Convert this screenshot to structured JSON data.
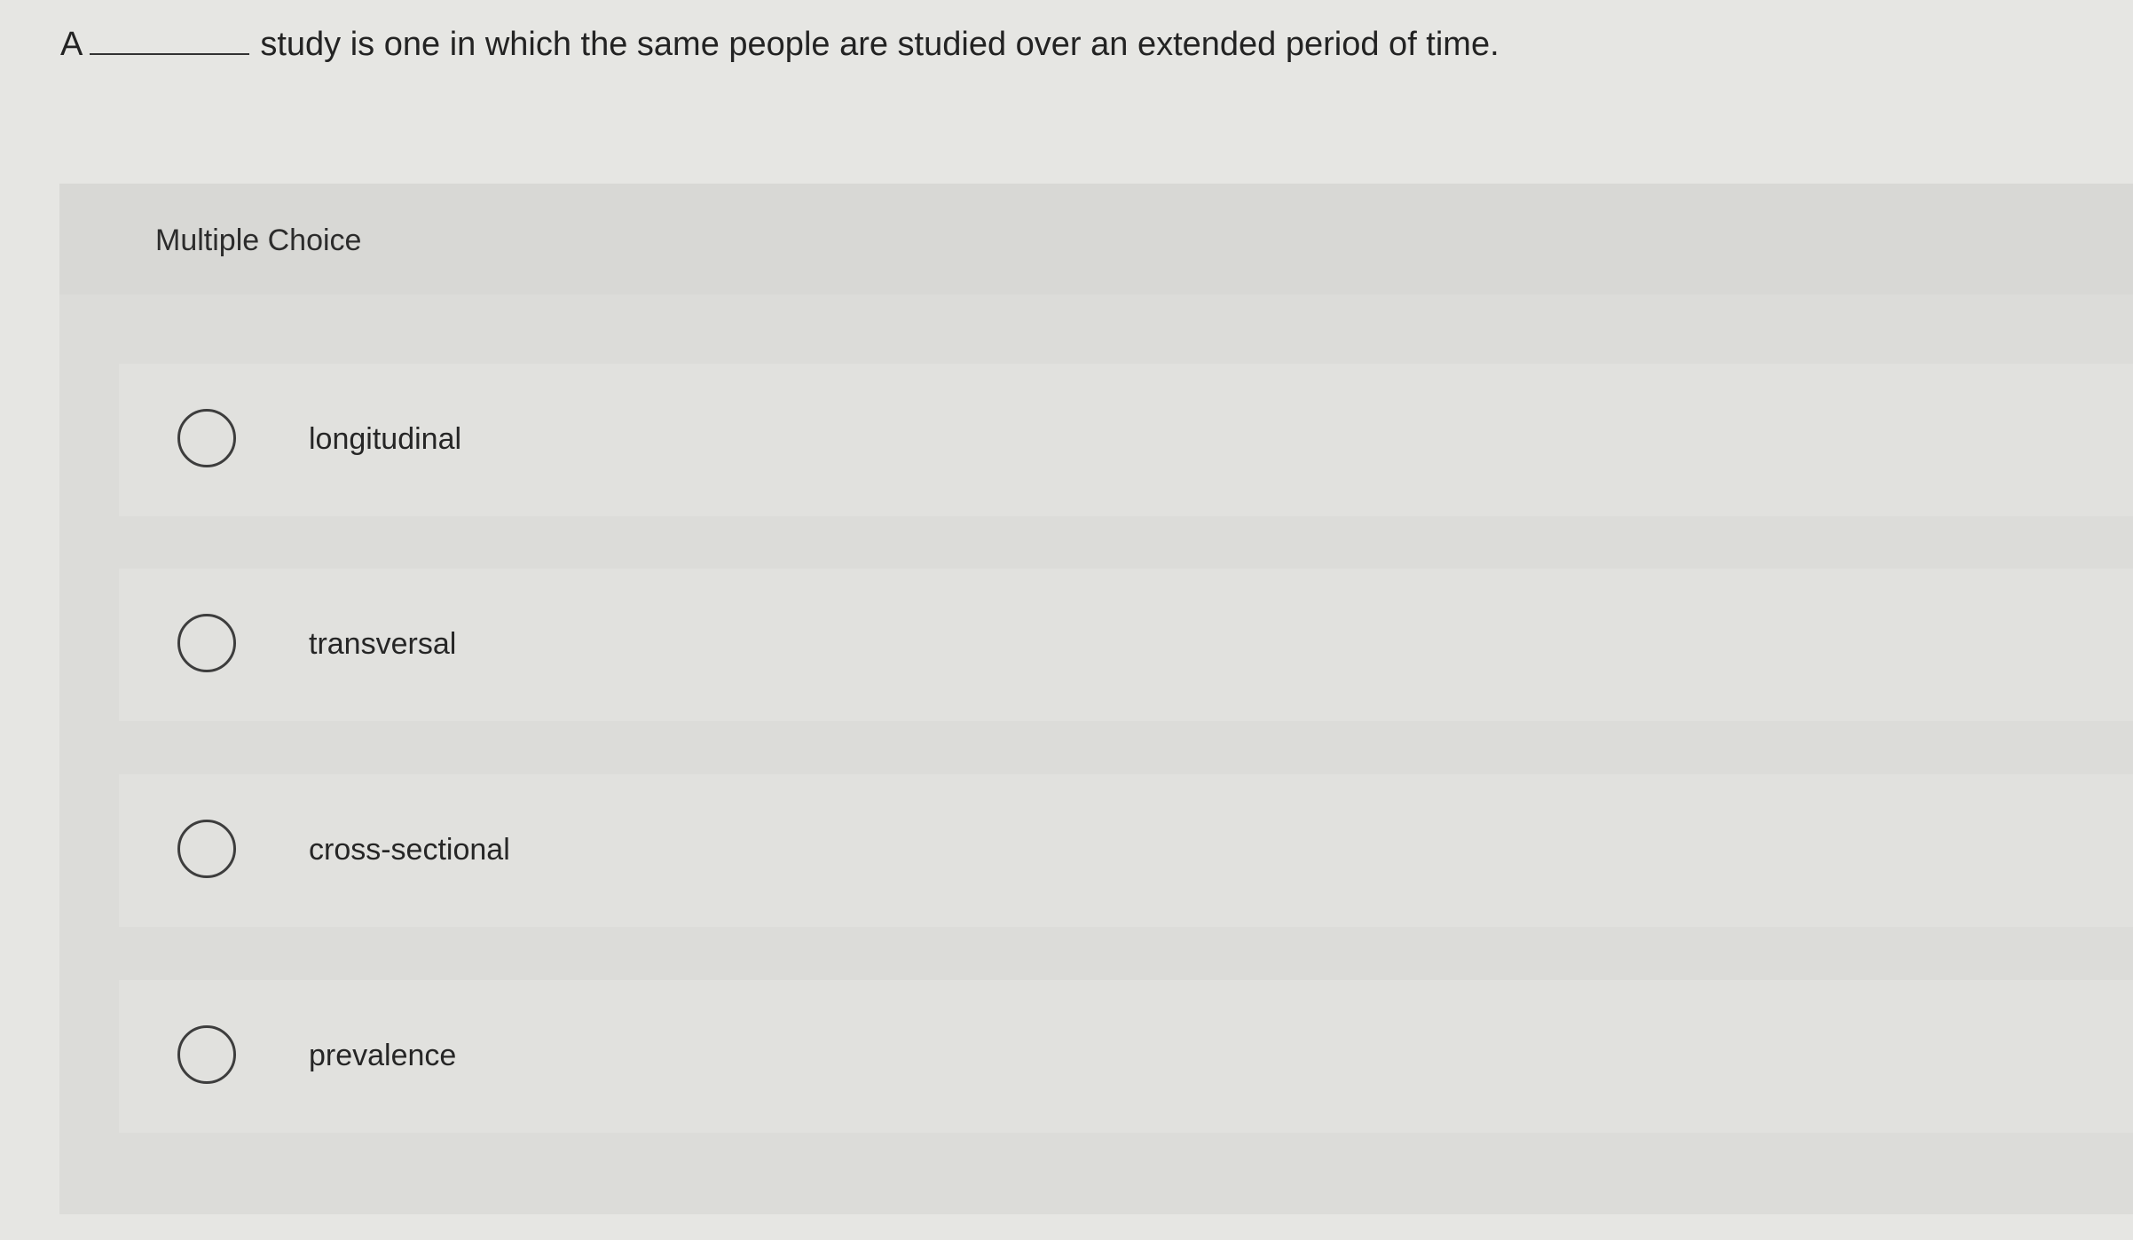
{
  "question": {
    "prefix": "A",
    "suffix": "study is one in which the same people are studied over an extended period of time."
  },
  "panel": {
    "title": "Multiple Choice"
  },
  "options": [
    {
      "label": "longitudinal",
      "selected": false
    },
    {
      "label": "transversal",
      "selected": false
    },
    {
      "label": "cross-sectional",
      "selected": false
    },
    {
      "label": "prevalence",
      "selected": false
    }
  ]
}
